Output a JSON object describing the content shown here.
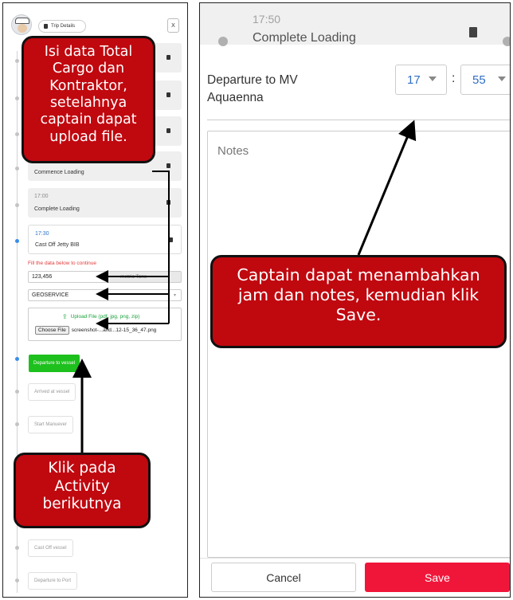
{
  "left_panel": {
    "header": {
      "trip_details_label": "Trip Details",
      "close_label": "X"
    },
    "cards": [
      {
        "time": "",
        "label": ""
      },
      {
        "time": "",
        "label": ""
      },
      {
        "time": "",
        "label": ""
      },
      {
        "time": "",
        "label": "Commence Loading"
      },
      {
        "time": "17:00",
        "label": "Complete Loading"
      },
      {
        "time": "17:30",
        "label": "Cast Off Jetty BIB"
      }
    ],
    "form": {
      "hint": "Fill the data below to continue",
      "total_cargo_value": "123,456",
      "total_cargo_suffix": "metric Tons",
      "contractor_value": "GEOSERVICE",
      "upload_label": "Upload File (pdf, jpg, png, zip)",
      "choose_file_label": "Choose File",
      "chosen_file_name": "screenshot-...and...12-15_36_47.png"
    },
    "activities": {
      "current": "Departure to vessel",
      "next": [
        "Arrived at vessel",
        "Start Manuever",
        "",
        "",
        "",
        "Cast Off vessel",
        "Departure to Port"
      ]
    }
  },
  "callouts": {
    "top_left": "Isi data Total Cargo dan Kontraktor, setelahnya captain dapat upload file.",
    "bottom_left": "Klik pada Activity berikutnya",
    "right": "Captain dapat menambahkan jam dan notes, kemudian klik Save."
  },
  "right_panel": {
    "background": {
      "time": "17:50",
      "label": "Complete Loading"
    },
    "title": "Departure to MV Aquaenna",
    "hour": "17",
    "minute": "55",
    "separator": ":",
    "notes_placeholder": "Notes",
    "cancel_label": "Cancel",
    "save_label": "Save"
  },
  "colors": {
    "callout_red": "#c0080f",
    "green_button": "#1ec01e",
    "save_red": "#f0163a",
    "hint_red": "#e23b3b",
    "timeline_blue": "#3a8de8",
    "upload_green": "#1aa33a"
  },
  "icons": [
    "document-icon",
    "upload-icon",
    "chevron-down-icon",
    "captain-avatar"
  ]
}
